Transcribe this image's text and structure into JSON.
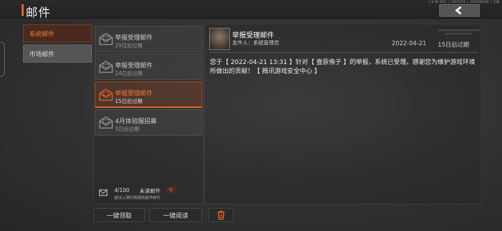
{
  "header": {
    "title": "邮件",
    "version": "1.0.90.9017 | 10515259 | 11653064288 | 万象",
    "back_icon": "chevron-left-icon"
  },
  "categories": [
    {
      "label": "系统邮件",
      "active": true
    },
    {
      "label": "市场邮件",
      "active": false
    }
  ],
  "mails": [
    {
      "title": "举报受理邮件",
      "expire": "29日后过期",
      "selected": false
    },
    {
      "title": "举报受理邮件",
      "expire": "24日后过期",
      "selected": false
    },
    {
      "title": "举报受理邮件",
      "expire": "15日后过期",
      "selected": true
    },
    {
      "title": "4月体验服招募",
      "expire": "3日后过期",
      "selected": false
    }
  ],
  "footer": {
    "count": "4/100",
    "unread_label": "未读邮件",
    "unread_count": "0",
    "note": "超出上限时将删除最早邮件"
  },
  "buttons": {
    "claim_all": "一键领取",
    "read_all": "一键阅读",
    "delete_icon": "trash-icon"
  },
  "detail": {
    "title": "举报受理邮件",
    "sender": "发件人：系统管理员",
    "date": "2022-04-21",
    "expire": "15日后过期",
    "body": "您于【 2022-04-21 13:31 】针对【 壹原侑子 】的举报，系统已受理。感谢您为维护游戏环境所做出的贡献！【 腾讯游戏安全中心 】"
  },
  "colors": {
    "accent": "#e0652a",
    "accent_text": "#f07a3e"
  }
}
